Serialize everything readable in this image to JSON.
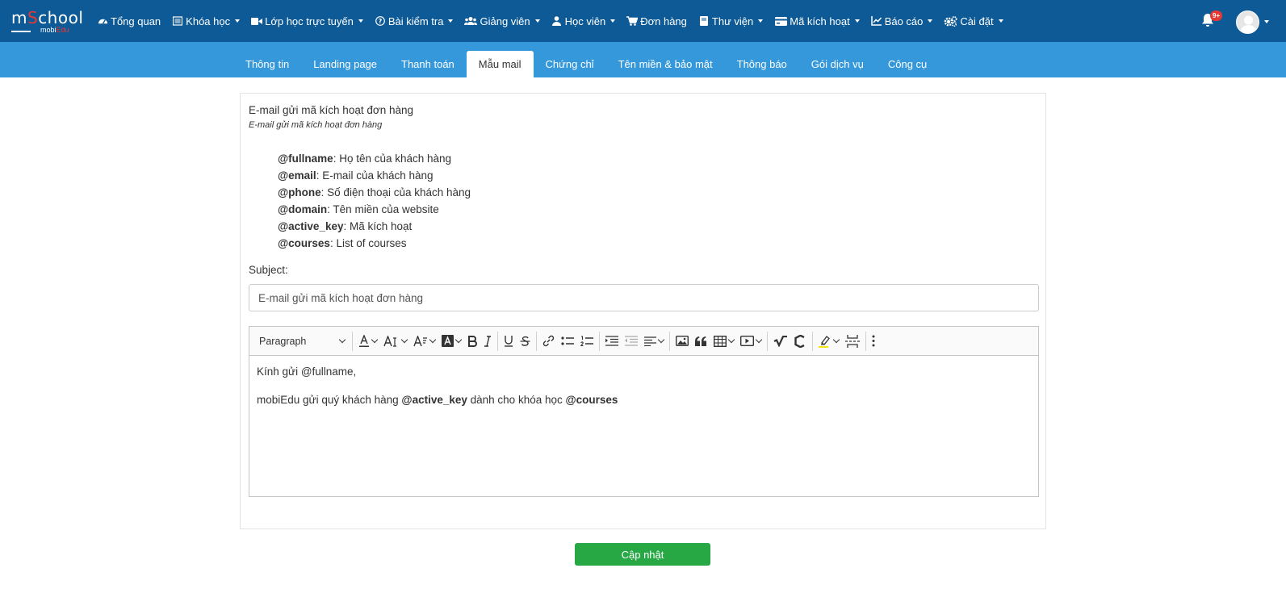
{
  "brand": {
    "logo_main_a": "m",
    "logo_main_o": "S",
    "logo_main_b": "chool",
    "logo_sub_a": "mobi",
    "logo_sub_b": "Edu"
  },
  "nav": {
    "items": [
      {
        "label": "Tổng quan",
        "icon": "dashboard-icon",
        "caret": false
      },
      {
        "label": "Khóa học",
        "icon": "list-icon",
        "caret": true
      },
      {
        "label": "Lớp học trực tuyến",
        "icon": "video-icon",
        "caret": true
      },
      {
        "label": "Bài kiểm tra",
        "icon": "question-icon",
        "caret": true
      },
      {
        "label": "Giảng viên",
        "icon": "users-icon",
        "caret": true
      },
      {
        "label": "Học viên",
        "icon": "user-icon",
        "caret": true
      },
      {
        "label": "Đơn hàng",
        "icon": "cart-icon",
        "caret": false
      },
      {
        "label": "Thư viện",
        "icon": "book-icon",
        "caret": true
      },
      {
        "label": "Mã kích hoạt",
        "icon": "card-icon",
        "caret": true
      },
      {
        "label": "Báo cáo",
        "icon": "chart-icon",
        "caret": true
      },
      {
        "label": "Cài đặt",
        "icon": "gears-icon",
        "caret": true
      }
    ],
    "notifications_badge": "9+"
  },
  "subnav": {
    "tabs": [
      "Thông tin",
      "Landing page",
      "Thanh toán",
      "Mẫu mail",
      "Chứng chỉ",
      "Tên miền & bảo mật",
      "Thông báo",
      "Gói dịch vụ",
      "Công cụ"
    ],
    "active_index": 3
  },
  "template": {
    "title": "E-mail gửi mã kích hoạt đơn hàng",
    "subtitle": "E-mail gửi mã kích hoạt đơn hàng",
    "variables": [
      {
        "key": "@fullname",
        "desc": ": Họ tên của khách hàng"
      },
      {
        "key": "@email",
        "desc": ": E-mail của khách hàng"
      },
      {
        "key": "@phone",
        "desc": ": Số điện thoại của khách hàng"
      },
      {
        "key": "@domain",
        "desc": ": Tên miền của website"
      },
      {
        "key": "@active_key",
        "desc": ": Mã kích hoạt"
      },
      {
        "key": "@courses",
        "desc": ": List of courses"
      }
    ],
    "subject_label": "Subject:",
    "subject_value": "E-mail gửi mã kích hoạt đơn hàng"
  },
  "editor": {
    "paragraph_select": "Paragraph",
    "body_line1": "Kính gửi @fullname,",
    "body_line2_a": "mobiEdu gửi quý khách hàng ",
    "body_line2_b": "@active_key",
    "body_line2_c": " dành cho khóa học ",
    "body_line2_d": "@courses"
  },
  "actions": {
    "update_label": "Cập nhật"
  },
  "colors": {
    "topnav": "#0d5a96",
    "subnav": "#3498db",
    "update_button": "#28a745",
    "badge": "#e53935"
  }
}
